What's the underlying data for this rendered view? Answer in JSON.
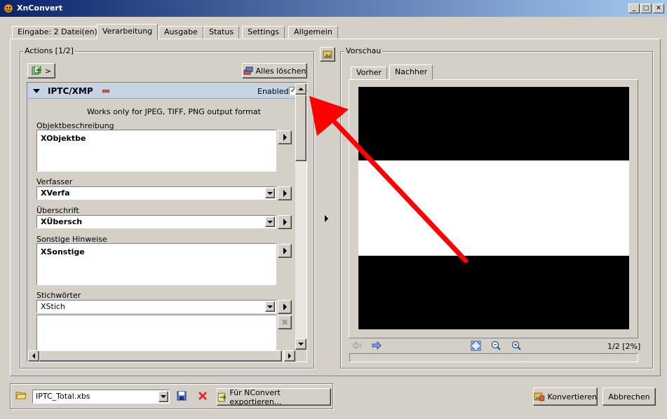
{
  "window": {
    "title": "XnConvert"
  },
  "tabs": [
    {
      "label": "Eingabe: 2 Datei(en)"
    },
    {
      "label": "Verarbeitung"
    },
    {
      "label": "Ausgabe"
    },
    {
      "label": "Status"
    },
    {
      "label": "Settings"
    },
    {
      "label": "Allgemein"
    }
  ],
  "actions": {
    "group_label": "Actions [1/2]",
    "add_button_label": ">",
    "clear_button_label": "Alles löschen",
    "item": {
      "title": "IPTC/XMP",
      "enabled_label": "Enabled",
      "enabled": true,
      "note": "Works only for JPEG, TIFF, PNG output format",
      "fields": {
        "objektbeschreibung": {
          "label": "Objektbeschreibung",
          "value": "XObjektbe"
        },
        "verfasser": {
          "label": "Verfasser",
          "value": "XVerfa"
        },
        "ueberschrift": {
          "label": "Überschrift",
          "value": "XÜbersch"
        },
        "sonstige": {
          "label": "Sonstige Hinweise",
          "value": "XSonstige"
        },
        "stichwoerter": {
          "label": "Stichwörter",
          "value": "XStich"
        }
      }
    }
  },
  "preview": {
    "group_label": "Vorschau",
    "tabs": [
      {
        "label": "Vorher"
      },
      {
        "label": "Nachher"
      }
    ],
    "page_info": "1/2 [2%]",
    "colors": {
      "dark": "#000000",
      "light": "#ffffff"
    }
  },
  "bottom": {
    "script_file": "IPTC_Total.xbs",
    "export_button_label": "Für NConvert exportieren...",
    "convert_button_label": "Konvertieren",
    "cancel_button_label": "Abbrechen"
  },
  "colors": {
    "title_start": "#0a246a",
    "title_end": "#a6caf0",
    "annotation_arrow": "#ff0000",
    "item_header_bg": "#c6d3e4"
  }
}
